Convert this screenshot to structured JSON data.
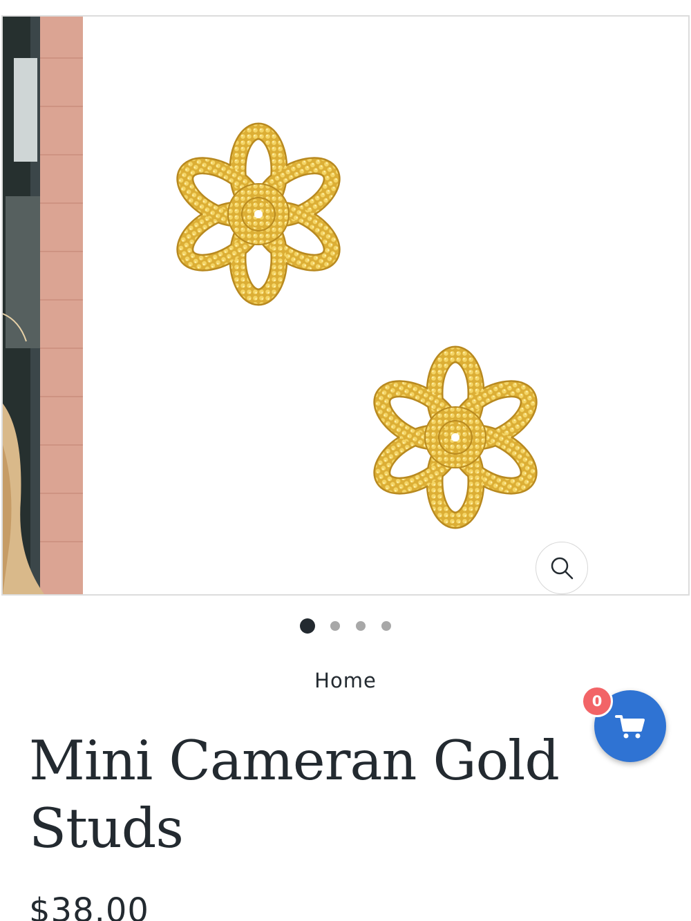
{
  "gallery": {
    "slide_count": 4,
    "active_slide": 1,
    "zoom_icon": "magnifier-icon",
    "product_image": "gold-flower-stud-earrings"
  },
  "breadcrumb": {
    "home_label": "Home"
  },
  "product": {
    "title": "Mini Cameran Gold Studs",
    "price": "$38.00"
  },
  "cart": {
    "icon": "shopping-cart-icon",
    "count": "0"
  },
  "colors": {
    "text": "#232a30",
    "accent_blue": "#2f73d3",
    "badge_red": "#f26467",
    "gold": "#e3b83e",
    "dot_active": "#232a30",
    "dot_inactive": "#a8a8a8"
  }
}
